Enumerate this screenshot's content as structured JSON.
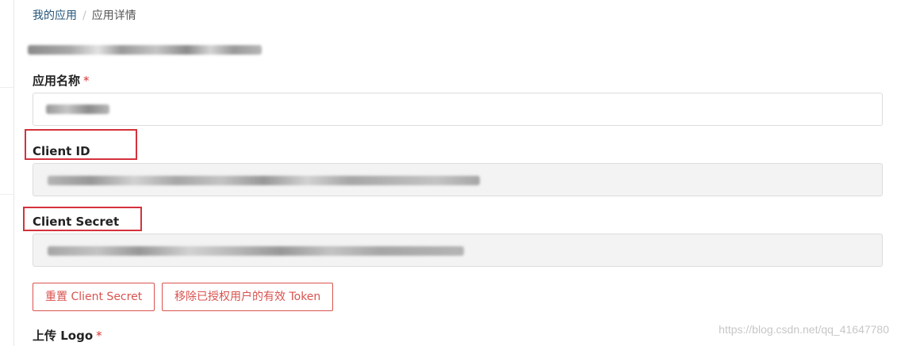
{
  "breadcrumb": {
    "root": "我的应用",
    "separator": "/",
    "current": "应用详情"
  },
  "form": {
    "app_name_label": "应用名称",
    "required_mark": "*",
    "client_id_label": "Client ID",
    "client_secret_label": "Client Secret",
    "upload_logo_label": "上传 Logo"
  },
  "actions": {
    "reset_secret": "重置 Client Secret",
    "revoke_tokens": "移除已授权用户的有效 Token"
  },
  "watermark": "https://blog.csdn.net/qq_41647780",
  "colors": {
    "link": "#24557a",
    "danger": "#d9534f",
    "highlight_box": "#d3323c",
    "readonly_bg": "#f3f3f3"
  }
}
